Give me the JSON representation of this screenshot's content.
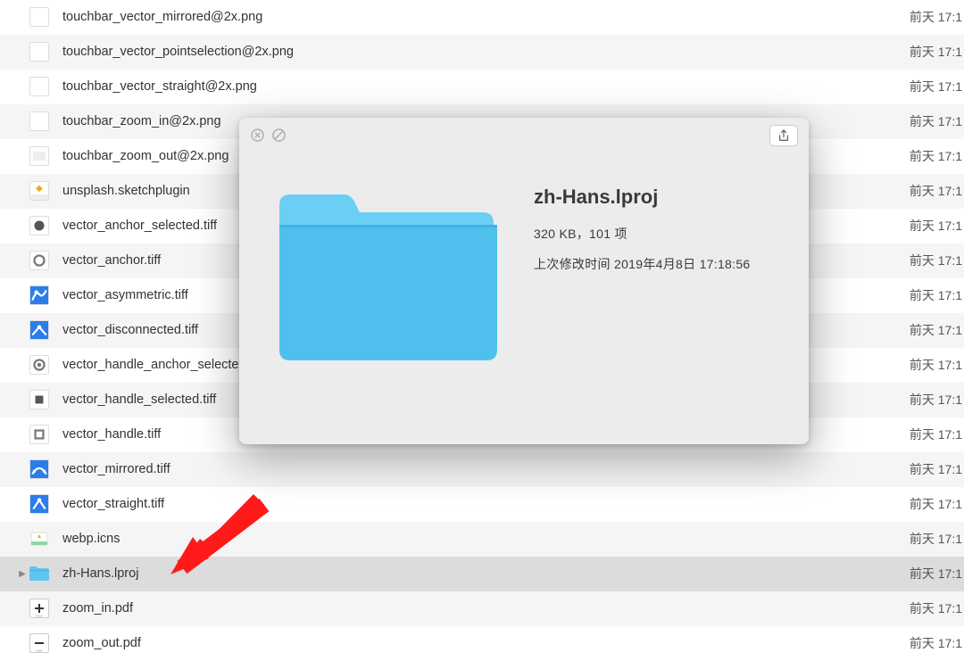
{
  "files": [
    {
      "name": "touchbar_vector_mirrored@2x.png",
      "date": "前天 17:1",
      "icon": "blank"
    },
    {
      "name": "touchbar_vector_pointselection@2x.png",
      "date": "前天 17:1",
      "icon": "blank"
    },
    {
      "name": "touchbar_vector_straight@2x.png",
      "date": "前天 17:1",
      "icon": "blank"
    },
    {
      "name": "touchbar_zoom_in@2x.png",
      "date": "前天 17:1",
      "icon": "blank"
    },
    {
      "name": "touchbar_zoom_out@2x.png",
      "date": "前天 17:1",
      "icon": "png-thumb"
    },
    {
      "name": "unsplash.sketchplugin",
      "date": "前天 17:1",
      "icon": "plugin"
    },
    {
      "name": "vector_anchor_selected.tiff",
      "date": "前天 17:1",
      "icon": "anchor-sel"
    },
    {
      "name": "vector_anchor.tiff",
      "date": "前天 17:1",
      "icon": "anchor"
    },
    {
      "name": "vector_asymmetric.tiff",
      "date": "前天 17:1",
      "icon": "curve-asym"
    },
    {
      "name": "vector_disconnected.tiff",
      "date": "前天 17:1",
      "icon": "curve-disc"
    },
    {
      "name": "vector_handle_anchor_selected.tiff",
      "date": "前天 17:1",
      "icon": "handle-anchor"
    },
    {
      "name": "vector_handle_selected.tiff",
      "date": "前天 17:1",
      "icon": "handle-sel"
    },
    {
      "name": "vector_handle.tiff",
      "date": "前天 17:1",
      "icon": "handle"
    },
    {
      "name": "vector_mirrored.tiff",
      "date": "前天 17:1",
      "icon": "curve-mirr"
    },
    {
      "name": "vector_straight.tiff",
      "date": "前天 17:1",
      "icon": "curve-straight"
    },
    {
      "name": "webp.icns",
      "date": "前天 17:1",
      "icon": "icns"
    },
    {
      "name": "zh-Hans.lproj",
      "date": "前天 17:1",
      "icon": "folder",
      "selected": true,
      "expandable": true
    },
    {
      "name": "zoom_in.pdf",
      "date": "前天 17:1",
      "icon": "pdf-plus"
    },
    {
      "name": "zoom_out.pdf",
      "date": "前天 17:1",
      "icon": "pdf-minus"
    }
  ],
  "quicklook": {
    "title": "zh-Hans.lproj",
    "size_items": "320 KB，101 项",
    "modified": "上次修改时间 2019年4月8日 17:18:56"
  }
}
